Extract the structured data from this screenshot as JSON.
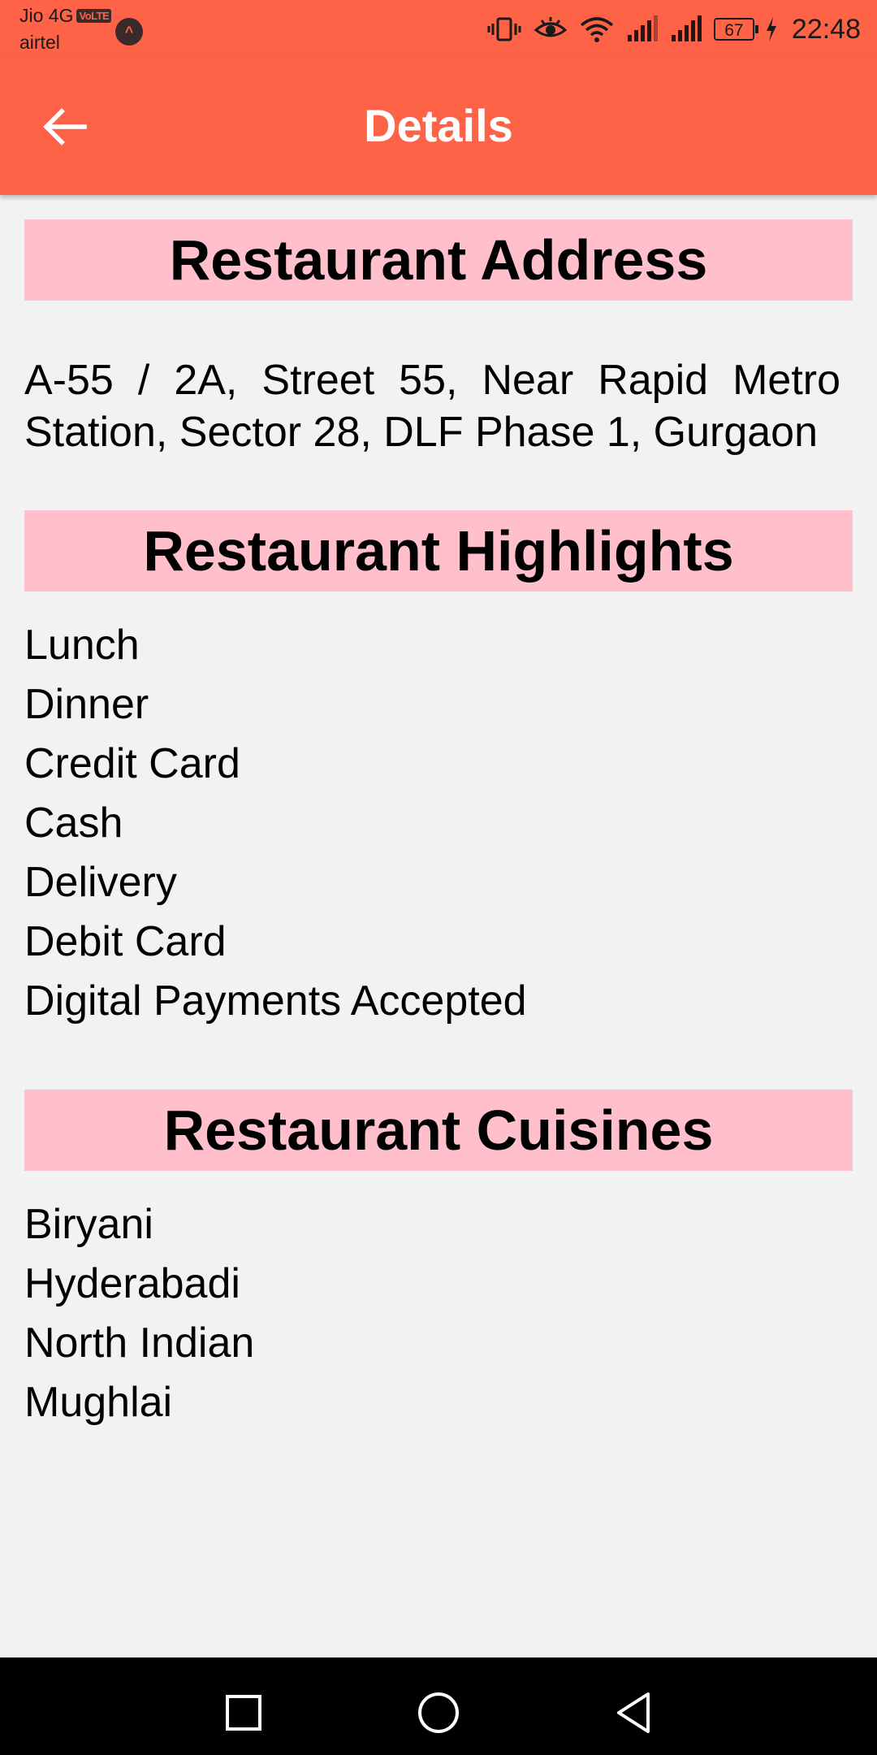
{
  "status_bar": {
    "carrier_primary": "Jio 4G",
    "volte_badge": "VoLTE",
    "carrier_secondary": "airtel",
    "app_badge": "^",
    "battery_level": "67",
    "time": "22:48",
    "icons": [
      "vibrate-icon",
      "eye-icon",
      "wifi-icon",
      "signal-icon",
      "signal-icon",
      "battery-icon",
      "charging-icon"
    ]
  },
  "app_bar": {
    "title": "Details",
    "back_icon": "arrow-back-icon",
    "color": "#fe6347"
  },
  "sections": {
    "address": {
      "header": "Restaurant Address",
      "text": "A-55 / 2A, Street 55, Near Rapid Metro Station, Sector 28, DLF Phase 1, Gurgaon"
    },
    "highlights": {
      "header": "Restaurant Highlights",
      "items": [
        "Lunch",
        "Dinner",
        "Credit Card",
        "Cash",
        "Delivery",
        "Debit Card",
        "Digital Payments Accepted"
      ]
    },
    "cuisines": {
      "header": "Restaurant Cuisines",
      "items": [
        "Biryani",
        "Hyderabadi",
        "North Indian",
        "Mughlai"
      ]
    }
  },
  "nav_bar": {
    "buttons": [
      "recent-apps-icon",
      "home-icon",
      "back-triangle-icon"
    ]
  },
  "colors": {
    "accent": "#fe6347",
    "section_header_bg": "#ffc0cb",
    "background": "#f2f2f2"
  }
}
